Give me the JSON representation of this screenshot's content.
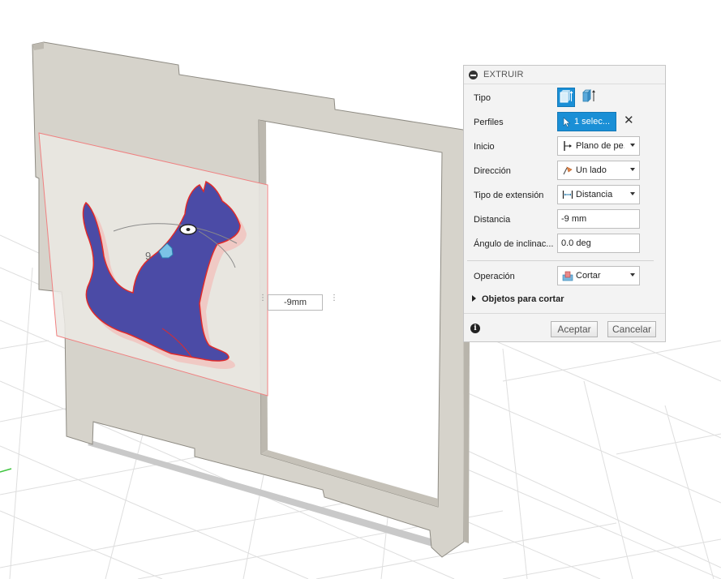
{
  "viewport": {
    "manipulator_value": "9",
    "distance_box": "-9mm"
  },
  "dialog": {
    "title": "EXTRUIR",
    "tipo_label": "Tipo",
    "perfiles_label": "Perfiles",
    "perfiles_value": "1 selec...",
    "inicio_label": "Inicio",
    "inicio_value": "Plano de pe...",
    "direccion_label": "Dirección",
    "direccion_value": "Un lado",
    "tipo_extension_label": "Tipo de extensión",
    "tipo_extension_value": "Distancia",
    "distancia_label": "Distancia",
    "distancia_value": "-9 mm",
    "angulo_label": "Ángulo de inclinac...",
    "angulo_value": "0.0 deg",
    "operacion_label": "Operación",
    "operacion_value": "Cortar",
    "objetos_label": "Objetos para cortar",
    "ok_label": "Aceptar",
    "cancel_label": "Cancelar"
  },
  "icons": [
    "collapse-icon",
    "solid-extrude-icon",
    "surface-extrude-icon",
    "cursor-icon",
    "close-icon",
    "start-plane-icon",
    "direction-icon",
    "extent-distance-icon",
    "cut-operation-icon",
    "info-icon",
    "chevron-down-icon"
  ],
  "colors": {
    "accent": "#1a8fd6",
    "profile_fill": "#4b4ba6",
    "profile_outline": "#e02a2a",
    "panel": "#d6d3cb",
    "grid": "#dcdcdc"
  }
}
